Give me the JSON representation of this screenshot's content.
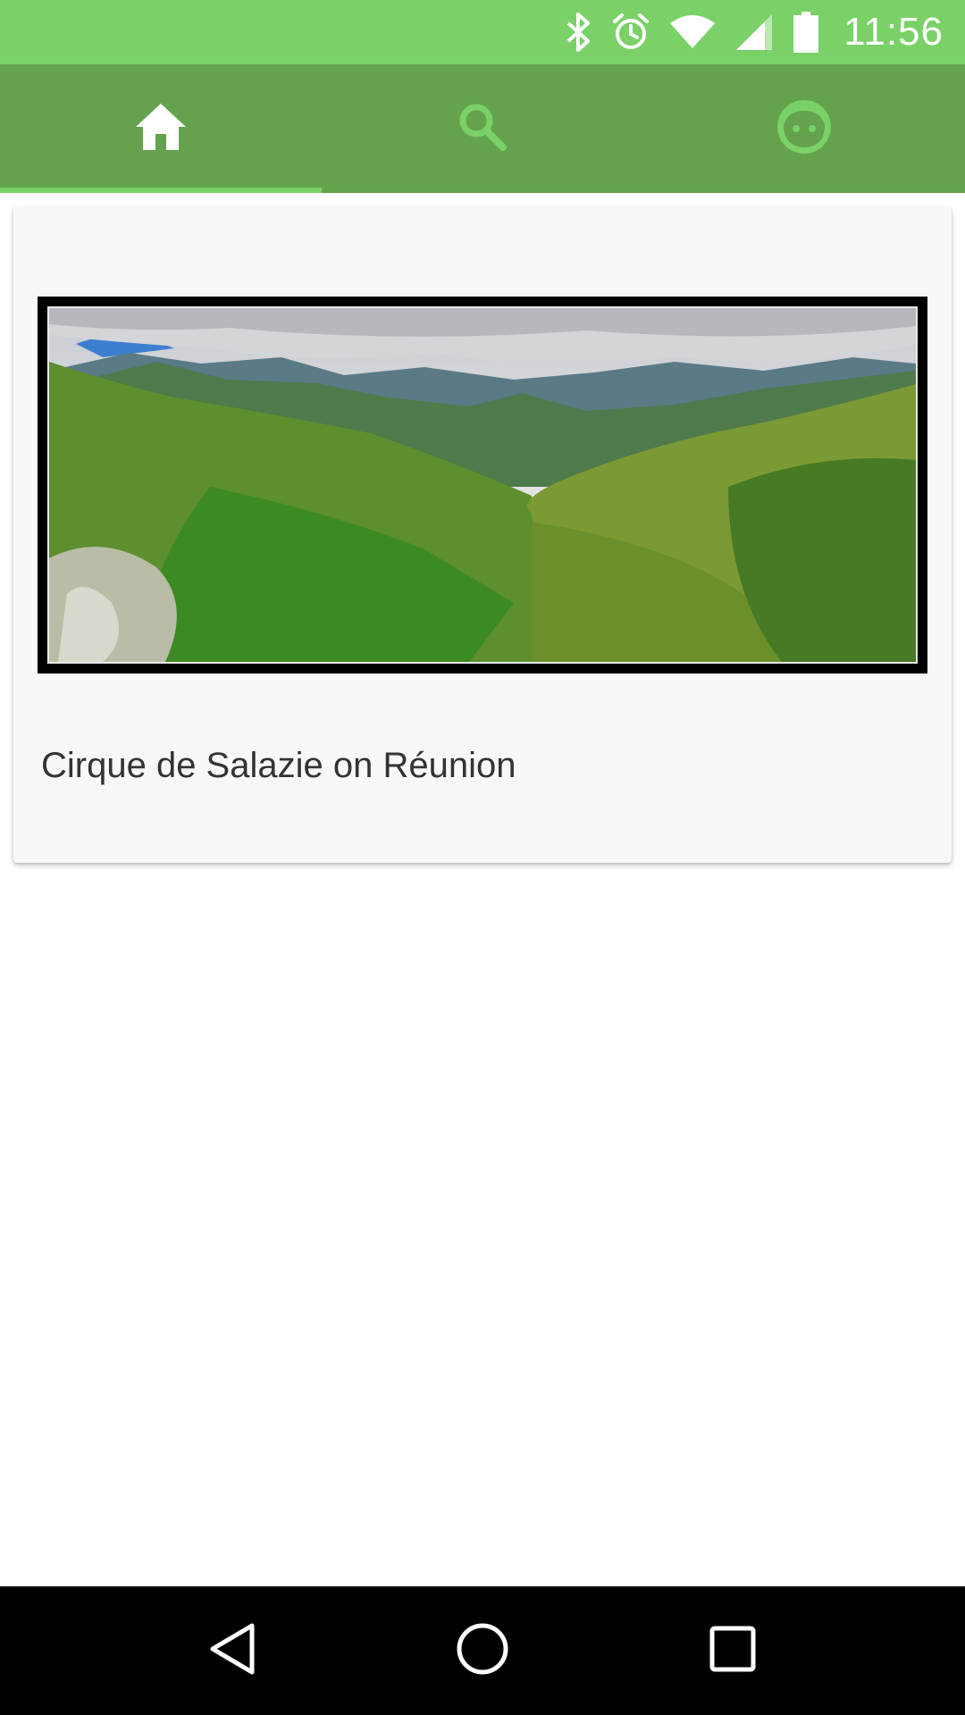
{
  "status_bar": {
    "time": "11:56",
    "icons": [
      "bluetooth-icon",
      "alarm-icon",
      "wifi-icon",
      "signal-icon",
      "battery-icon"
    ],
    "background_color": "#7ad168"
  },
  "tab_bar": {
    "background_color": "#64a24d",
    "indicator_color": "#7ad168",
    "tabs": [
      {
        "icon": "home-icon",
        "selected": true
      },
      {
        "icon": "search-icon",
        "selected": false
      },
      {
        "icon": "face-icon",
        "selected": false
      }
    ]
  },
  "card": {
    "image_description_icon": "landscape-image",
    "title": "Cirque de Salazie on Réunion"
  },
  "nav_bar": {
    "buttons": [
      "back-icon",
      "home-circle-icon",
      "recents-icon"
    ]
  }
}
